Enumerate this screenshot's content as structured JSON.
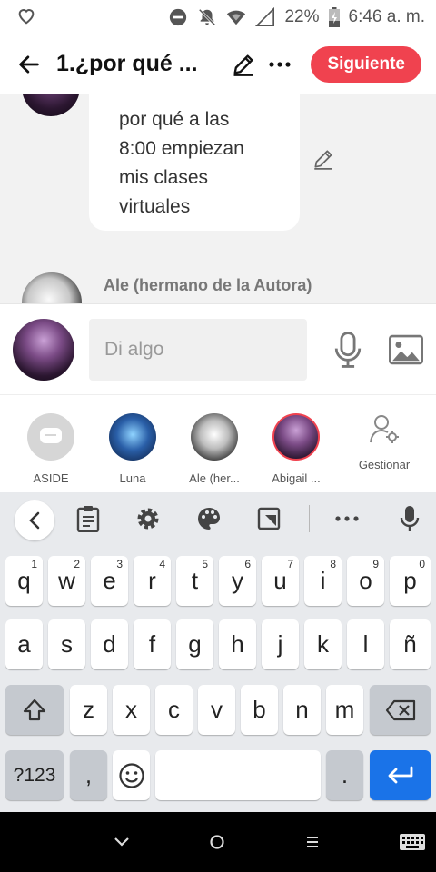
{
  "status_bar": {
    "battery": "22%",
    "time": "6:46 a. m."
  },
  "header": {
    "title": "1.¿por qué ...",
    "next_label": "Siguiente"
  },
  "chat": {
    "message_lines": [
      "por qué a las",
      "8:00 empiezan",
      "mis clases",
      "virtuales"
    ],
    "author": "Ale (hermano de la Autora)"
  },
  "composer": {
    "placeholder": "Di algo"
  },
  "characters": [
    {
      "name": "ASIDE"
    },
    {
      "name": "Luna"
    },
    {
      "name": "Ale (her..."
    },
    {
      "name": "Abigail ..."
    }
  ],
  "manage_label": "Gestionar",
  "keyboard": {
    "row1": [
      {
        "k": "q",
        "n": "1"
      },
      {
        "k": "w",
        "n": "2"
      },
      {
        "k": "e",
        "n": "3"
      },
      {
        "k": "r",
        "n": "4"
      },
      {
        "k": "t",
        "n": "5"
      },
      {
        "k": "y",
        "n": "6"
      },
      {
        "k": "u",
        "n": "7"
      },
      {
        "k": "i",
        "n": "8"
      },
      {
        "k": "o",
        "n": "9"
      },
      {
        "k": "p",
        "n": "0"
      }
    ],
    "row2": [
      "a",
      "s",
      "d",
      "f",
      "g",
      "h",
      "j",
      "k",
      "l",
      "ñ"
    ],
    "row3": [
      "z",
      "x",
      "c",
      "v",
      "b",
      "n",
      "m"
    ],
    "symbols_label": "?123",
    "comma": ",",
    "period": "."
  },
  "colors": {
    "accent": "#f0424f",
    "enter": "#1a73e8"
  }
}
